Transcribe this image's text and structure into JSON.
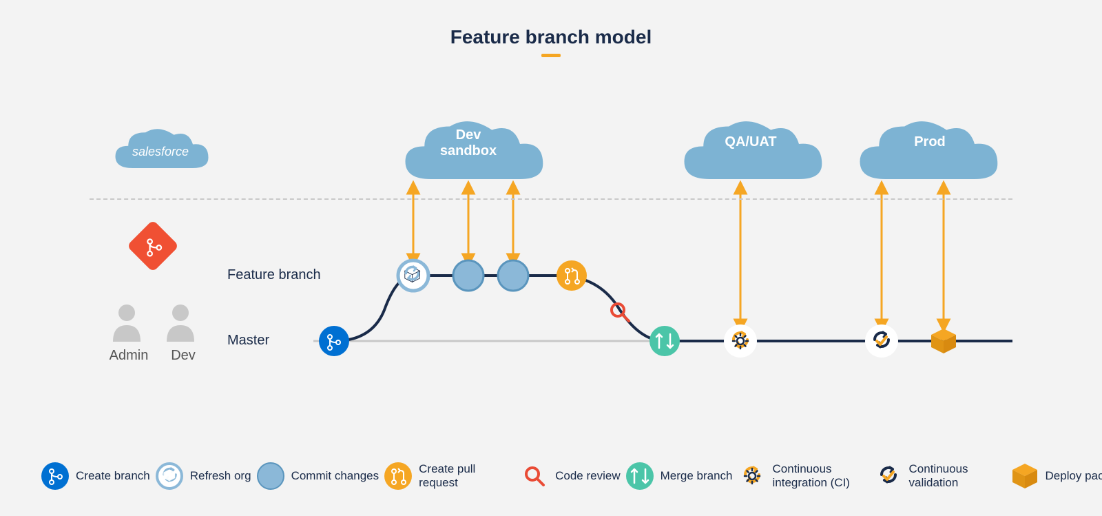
{
  "title": "Feature branch model",
  "clouds": {
    "salesforce": "salesforce",
    "dev_sandbox": "Dev sandbox",
    "qa_uat": "QA/UAT",
    "prod": "Prod"
  },
  "branches": {
    "feature": "Feature branch",
    "master": "Master"
  },
  "roles": {
    "admin": "Admin",
    "dev": "Dev"
  },
  "legend": {
    "create_branch": "Create branch",
    "refresh_org": "Refresh org",
    "commit_changes": "Commit changes",
    "create_pull_request": "Create pull request",
    "code_review": "Code review",
    "merge_branch": "Merge branch",
    "continuous_integration": "Continuous integration (CI)",
    "continuous_validation": "Continuous validation",
    "deploy_package": "Deploy package"
  },
  "icons": {
    "create_branch": "branch-icon",
    "refresh_org": "cube-refresh-icon",
    "commit_changes": "commit-icon",
    "create_pull_request": "pull-request-icon",
    "code_review": "magnifier-icon",
    "merge_branch": "merge-icon",
    "continuous_integration": "gear-cycle-icon",
    "continuous_validation": "check-cycle-icon",
    "deploy_package": "cube-icon",
    "git": "git-icon",
    "person": "person-icon"
  },
  "colors": {
    "navy": "#1a2b49",
    "orange": "#f5a623",
    "cloud": "#7db3d3",
    "blue_dark": "#0070d2",
    "blue_light": "#8bb8d8",
    "teal": "#4bc5a8",
    "red": "#e94b35",
    "git": "#f05033"
  }
}
